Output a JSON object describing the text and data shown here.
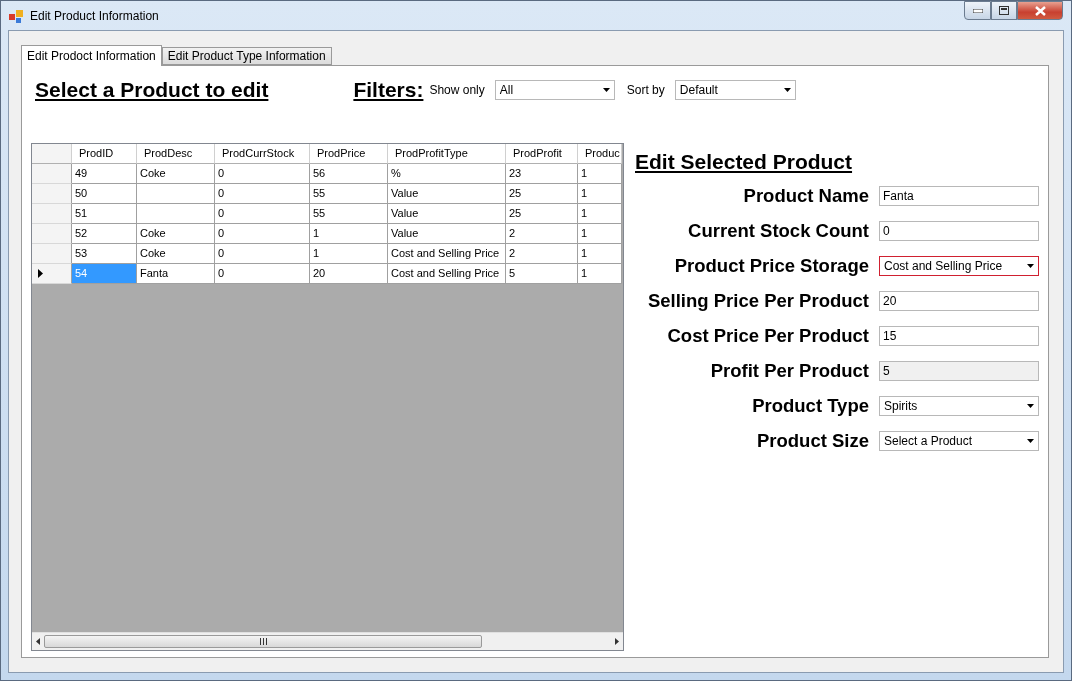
{
  "window": {
    "title": "Edit Product Information"
  },
  "tabs": [
    {
      "label": "Edit Prodoct Information",
      "selected": true
    },
    {
      "label": "Edit Product Type Information",
      "selected": false
    }
  ],
  "heading": "Select a Product to edit",
  "filters": {
    "title": "Filters:",
    "show_only_label": "Show only",
    "show_only_value": "All",
    "sort_by_label": "Sort by",
    "sort_by_value": "Default"
  },
  "grid": {
    "columns": [
      "ProdID",
      "ProdDesc",
      "ProdCurrStock",
      "ProdPrice",
      "ProdProfitType",
      "ProdProfit",
      "Produc"
    ],
    "rows": [
      {
        "cells": [
          "49",
          "Coke",
          "0",
          "56",
          "%",
          "23",
          "1"
        ],
        "selected": false
      },
      {
        "cells": [
          "50",
          "",
          "0",
          "55",
          "Value",
          "25",
          "1"
        ],
        "selected": false
      },
      {
        "cells": [
          "51",
          "",
          "0",
          "55",
          "Value",
          "25",
          "1"
        ],
        "selected": false
      },
      {
        "cells": [
          "52",
          "Coke",
          "0",
          "1",
          "Value",
          "2",
          "1"
        ],
        "selected": false
      },
      {
        "cells": [
          "53",
          "Coke",
          "0",
          "1",
          "Cost and Selling Price",
          "2",
          "1"
        ],
        "selected": false
      },
      {
        "cells": [
          "54",
          "Fanta",
          "0",
          "20",
          "Cost and Selling Price",
          "5",
          "1"
        ],
        "selected": true
      }
    ]
  },
  "edit_panel": {
    "title": "Edit Selected Product",
    "fields": [
      {
        "label": "Product Name",
        "kind": "text",
        "value": "Fanta",
        "highlighted": false
      },
      {
        "label": "Current Stock Count",
        "kind": "text",
        "value": "0",
        "highlighted": false
      },
      {
        "label": "Product Price Storage",
        "kind": "dropdown",
        "value": "Cost and Selling Price",
        "highlighted": true
      },
      {
        "label": "Selling Price Per Product",
        "kind": "text",
        "value": "20",
        "highlighted": false
      },
      {
        "label": "Cost Price Per Product",
        "kind": "text",
        "value": "15",
        "highlighted": false
      },
      {
        "label": "Profit Per Product",
        "kind": "readonly",
        "value": "5",
        "highlighted": false
      },
      {
        "label": "Product Type",
        "kind": "dropdown",
        "value": "Spirits",
        "highlighted": false
      },
      {
        "label": "Product Size",
        "kind": "dropdown",
        "value": "Select a Product",
        "highlighted": false
      }
    ]
  }
}
